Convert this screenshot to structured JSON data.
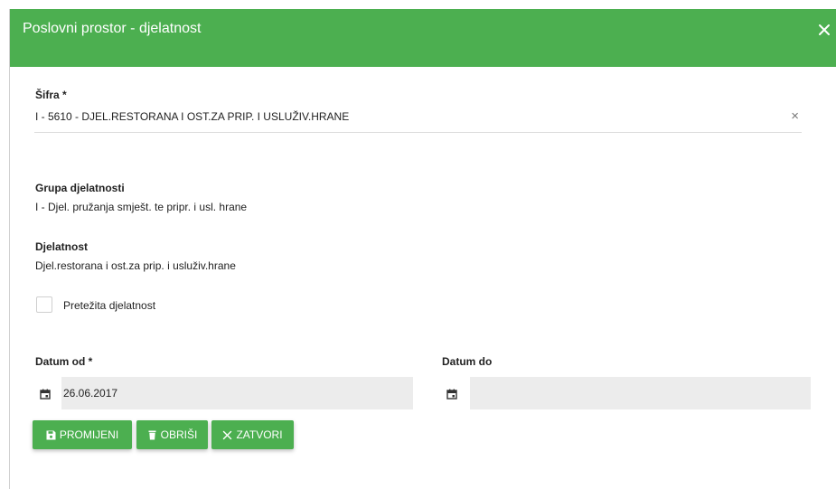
{
  "dialog": {
    "title": "Poslovni prostor - djelatnost"
  },
  "sifra": {
    "label": "Šifra *",
    "value": "I - 5610 - DJEL.RESTORANA I OST.ZA PRIP. I USLUŽIV.HRANE",
    "clear_glyph": "×"
  },
  "grupa": {
    "label": "Grupa djelatnosti",
    "value": "I - Djel. pružanja smješt. te pripr. i usl. hrane"
  },
  "djelatnost": {
    "label": "Djelatnost",
    "value": "Djel.restorana i ost.za prip. i usluživ.hrane"
  },
  "pretezita": {
    "label": "Pretežita djelatnost",
    "checked": false
  },
  "datum_od": {
    "label": "Datum od *",
    "value": "26.06.2017"
  },
  "datum_do": {
    "label": "Datum do",
    "value": ""
  },
  "buttons": {
    "promijeni": "PROMIJENI",
    "obrisi": "OBRIŠI",
    "zatvori": "ZATVORI"
  },
  "colors": {
    "accent": "#4caf50",
    "input_bg": "#ececec"
  },
  "icons": {
    "close": "close-icon",
    "save": "floppy-disk-icon",
    "delete": "trash-icon",
    "cancel": "x-icon",
    "calendar": "calendar-icon"
  }
}
